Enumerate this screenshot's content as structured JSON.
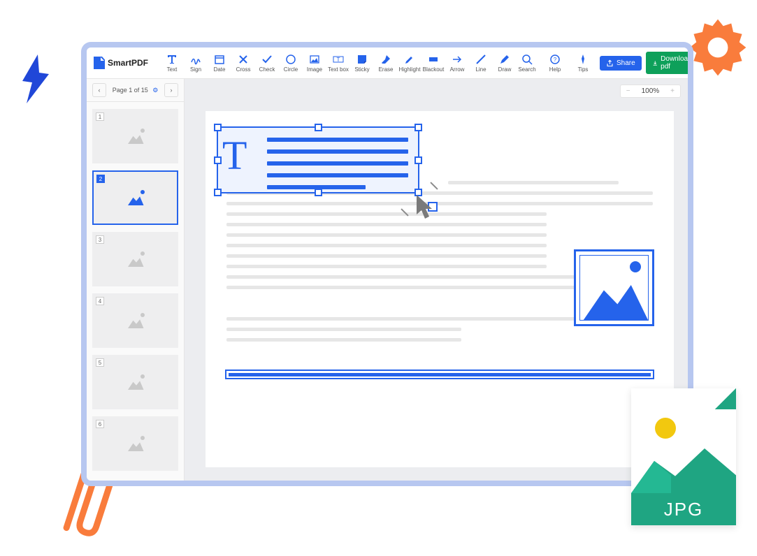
{
  "app": {
    "name": "SmartPDF"
  },
  "toolbar": {
    "tools": [
      {
        "label": "Text",
        "icon": "text"
      },
      {
        "label": "Sign",
        "icon": "sign"
      },
      {
        "label": "Date",
        "icon": "date"
      },
      {
        "label": "Cross",
        "icon": "cross"
      },
      {
        "label": "Check",
        "icon": "check"
      },
      {
        "label": "Circle",
        "icon": "circle"
      },
      {
        "label": "Image",
        "icon": "image"
      },
      {
        "label": "Text box",
        "icon": "textbox"
      },
      {
        "label": "Sticky",
        "icon": "sticky"
      },
      {
        "label": "Erase",
        "icon": "erase"
      },
      {
        "label": "Highlight",
        "icon": "highlight"
      },
      {
        "label": "Blackout",
        "icon": "blackout"
      },
      {
        "label": "Arrow",
        "icon": "arrow"
      },
      {
        "label": "Line",
        "icon": "line"
      },
      {
        "label": "Draw",
        "icon": "draw"
      }
    ],
    "search": "Search",
    "help": "Help",
    "tips": "Tips",
    "share": "Share",
    "download": "Download pdf"
  },
  "sidebar": {
    "page_label": "Page 1 of 15",
    "thumbs": [
      {
        "num": "1"
      },
      {
        "num": "2"
      },
      {
        "num": "3"
      },
      {
        "num": "4"
      },
      {
        "num": "5"
      },
      {
        "num": "6"
      }
    ],
    "selected": 2
  },
  "zoom": {
    "value": "100%"
  },
  "jpg_label": "JPG"
}
